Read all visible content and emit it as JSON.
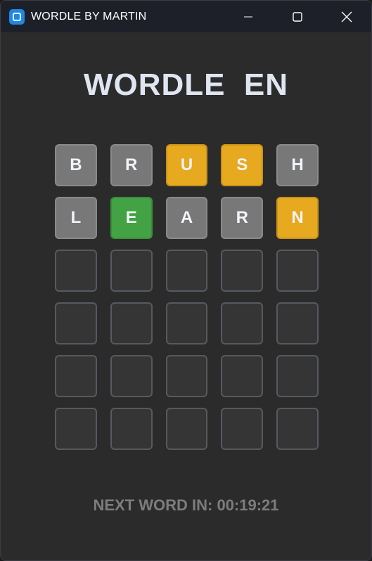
{
  "window": {
    "title": "WORDLE BY MARTIN",
    "icon": "app-icon",
    "controls": [
      "minimize-icon",
      "maximize-icon",
      "close-icon"
    ]
  },
  "game": {
    "heading": "WORDLE  EN",
    "rows": [
      [
        {
          "letter": "B",
          "state": "absent"
        },
        {
          "letter": "R",
          "state": "absent"
        },
        {
          "letter": "U",
          "state": "present"
        },
        {
          "letter": "S",
          "state": "present"
        },
        {
          "letter": "H",
          "state": "absent"
        }
      ],
      [
        {
          "letter": "L",
          "state": "absent"
        },
        {
          "letter": "E",
          "state": "correct"
        },
        {
          "letter": "A",
          "state": "absent"
        },
        {
          "letter": "R",
          "state": "absent"
        },
        {
          "letter": "N",
          "state": "present"
        }
      ],
      [
        {
          "letter": "",
          "state": "empty"
        },
        {
          "letter": "",
          "state": "empty"
        },
        {
          "letter": "",
          "state": "empty"
        },
        {
          "letter": "",
          "state": "empty"
        },
        {
          "letter": "",
          "state": "empty"
        }
      ],
      [
        {
          "letter": "",
          "state": "empty"
        },
        {
          "letter": "",
          "state": "empty"
        },
        {
          "letter": "",
          "state": "empty"
        },
        {
          "letter": "",
          "state": "empty"
        },
        {
          "letter": "",
          "state": "empty"
        }
      ],
      [
        {
          "letter": "",
          "state": "empty"
        },
        {
          "letter": "",
          "state": "empty"
        },
        {
          "letter": "",
          "state": "empty"
        },
        {
          "letter": "",
          "state": "empty"
        },
        {
          "letter": "",
          "state": "empty"
        }
      ],
      [
        {
          "letter": "",
          "state": "empty"
        },
        {
          "letter": "",
          "state": "empty"
        },
        {
          "letter": "",
          "state": "empty"
        },
        {
          "letter": "",
          "state": "empty"
        },
        {
          "letter": "",
          "state": "empty"
        }
      ]
    ],
    "next_word_text": "NEXT WORD IN: 00:19:21"
  },
  "colors": {
    "absent": "#787878",
    "present": "#e6a91f",
    "correct": "#43a344",
    "empty": "#353535",
    "background": "#2b2b2b",
    "titlebar": "#1d2029"
  }
}
